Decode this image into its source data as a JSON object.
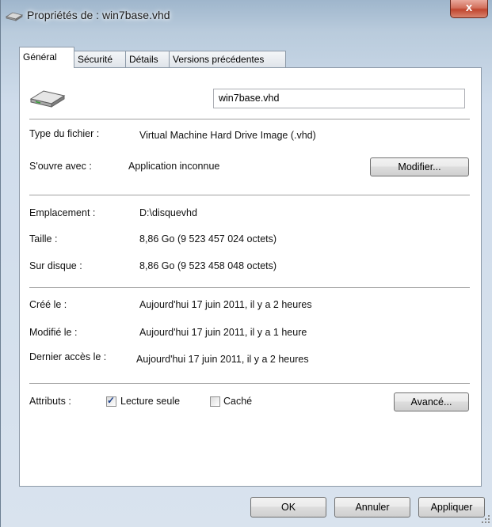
{
  "window": {
    "title": "Propriétés de : win7base.vhd",
    "close_glyph": "x"
  },
  "tabs": [
    {
      "label": "Général",
      "active": true
    },
    {
      "label": "Sécurité",
      "active": false
    },
    {
      "label": "Détails",
      "active": false
    },
    {
      "label": "Versions précédentes",
      "active": false
    }
  ],
  "general": {
    "file_icon": "hard-drive-icon",
    "file_name": "win7base.vhd",
    "file_type_label": "Type du fichier :",
    "file_type_value": "Virtual Machine Hard Drive Image (.vhd)",
    "opens_with_label": "S'ouvre avec :",
    "opens_with_value": "Application inconnue",
    "modify_button": "Modifier...",
    "location_label": "Emplacement :",
    "location_value": "D:\\disquevhd",
    "size_label": "Taille :",
    "size_value": "8,86 Go (9 523 457 024 octets)",
    "disk_label": "Sur disque :",
    "disk_value": "8,86 Go (9 523 458 048 octets)",
    "created_label": "Créé le :",
    "created_value": "Aujourd'hui 17 juin 2011, il y a 2 heures",
    "modified_label": "Modifié le :",
    "modified_value": "Aujourd'hui 17 juin 2011, il y a 1 heure",
    "accessed_label": "Dernier accès le :",
    "accessed_value": "Aujourd'hui 17 juin 2011, il y a 2 heures",
    "attributes_label": "Attributs :",
    "readonly_label": "Lecture seule",
    "readonly_checked": true,
    "hidden_label": "Caché",
    "hidden_checked": false,
    "advanced_button": "Avancé..."
  },
  "footer": {
    "ok_button": "OK",
    "cancel_button": "Annuler",
    "apply_button": "Appliquer"
  },
  "colors": {
    "frame": "#c9d7e6",
    "close_red": "#c0462f",
    "check_mark": "#1b3f8a"
  }
}
